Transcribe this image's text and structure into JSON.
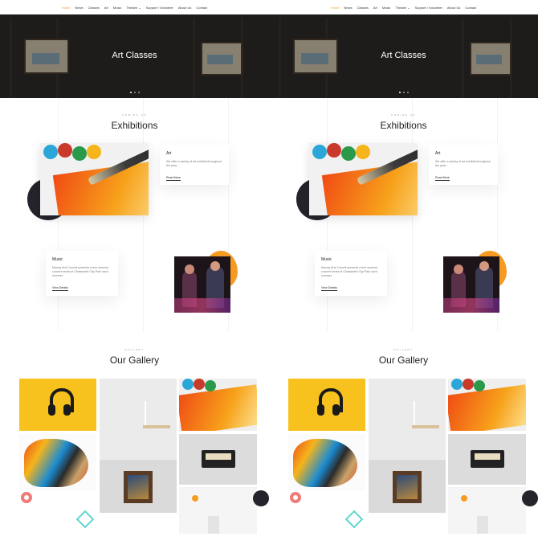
{
  "nav": {
    "items": [
      "Home",
      "News",
      "Classes",
      "Art",
      "Music",
      "Theatre ⌄",
      "Support / Volunteer",
      "About Us",
      "Contact"
    ],
    "active_index": 0,
    "active_color": "#f2a23a"
  },
  "hero": {
    "title": "Art Classes",
    "slider_dots": 3,
    "active_dot": 0
  },
  "exhibitions": {
    "kicker": "COMING UP",
    "title": "Exhibitions",
    "art": {
      "heading": "Art",
      "text": "We offer a variety of art exhibits throughout the year...",
      "link": "Read More"
    },
    "music": {
      "heading": "Music",
      "text": "Murray Arts Council presents a free summer concert series at Chatsworth City Park each summer.",
      "link": "View Details"
    }
  },
  "gallery": {
    "kicker": "GALLERY",
    "title": "Our Gallery",
    "tiles": [
      "headphones-photo",
      "chair-photo",
      "paint-brush-photo",
      "abstract-face-art",
      "cassette-tape-photo",
      "framed-portrait-photo",
      "lamp-photo"
    ]
  },
  "colors": {
    "accent": "#f2a23a",
    "orange": "#f69b21",
    "dark": "#25232b",
    "pink": "#f07c78",
    "teal": "#62d6cf"
  }
}
